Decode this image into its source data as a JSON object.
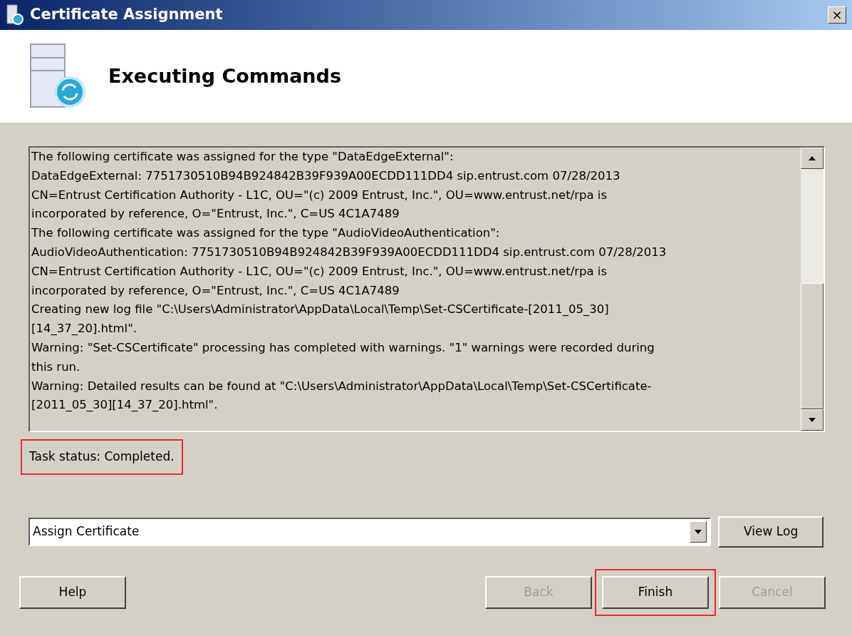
{
  "window": {
    "title": "Certificate Assignment",
    "close": "×"
  },
  "header": {
    "title": "Executing Commands"
  },
  "log": {
    "lines": [
      "The following certificate was assigned for the type \"DataEdgeExternal\":",
      "DataEdgeExternal: 7751730510B94B924842B39F939A00ECDD111DD4 sip.entrust.com 07/28/2013",
      "CN=Entrust Certification Authority - L1C, OU=\"(c) 2009 Entrust, Inc.\", OU=www.entrust.net/rpa is",
      "incorporated by reference, O=\"Entrust, Inc.\", C=US 4C1A7489",
      "The following certificate was assigned for the type \"AudioVideoAuthentication\":",
      "AudioVideoAuthentication: 7751730510B94B924842B39F939A00ECDD111DD4 sip.entrust.com 07/28/2013",
      "CN=Entrust Certification Authority - L1C, OU=\"(c) 2009 Entrust, Inc.\", OU=www.entrust.net/rpa is",
      "incorporated by reference, O=\"Entrust, Inc.\", C=US 4C1A7489",
      "Creating new log file \"C:\\Users\\Administrator\\AppData\\Local\\Temp\\Set-CSCertificate-[2011_05_30]",
      "[14_37_20].html\".",
      "Warning: \"Set-CSCertificate\" processing has completed with warnings. \"1\" warnings were recorded during",
      "this run.",
      "Warning: Detailed results can be found at \"C:\\Users\\Administrator\\AppData\\Local\\Temp\\Set-CSCertificate-",
      "[2011_05_30][14_37_20].html\"."
    ]
  },
  "status": {
    "text": "Task status: Completed.",
    "highlighted": true
  },
  "action": {
    "value": "Assign Certificate",
    "button": "View Log"
  },
  "buttons": [
    {
      "label": "Help",
      "disabled": false,
      "highlighted": false
    },
    {
      "label": "Back",
      "disabled": true,
      "highlighted": false
    },
    {
      "label": "Finish",
      "disabled": false,
      "highlighted": true
    },
    {
      "label": "Cancel",
      "disabled": true,
      "highlighted": false
    }
  ]
}
